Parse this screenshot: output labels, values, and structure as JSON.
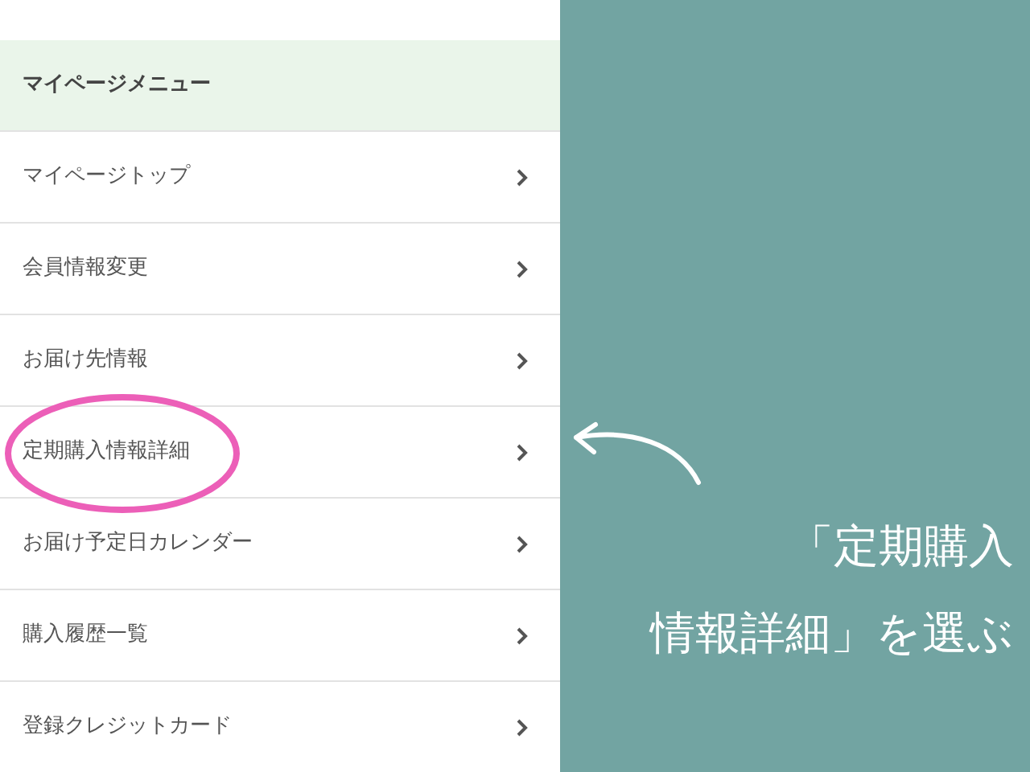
{
  "menu": {
    "title": "マイページメニュー",
    "items": [
      {
        "label": "マイページトップ",
        "circled": false
      },
      {
        "label": "会員情報変更",
        "circled": false
      },
      {
        "label": "お届け先情報",
        "circled": false
      },
      {
        "label": "定期購入情報詳細",
        "circled": true
      },
      {
        "label": "お届け予定日カレンダー",
        "circled": false
      },
      {
        "label": "購入履歴一覧",
        "circled": false
      },
      {
        "label": "登録クレジットカード",
        "circled": false
      }
    ]
  },
  "callout": {
    "lines": [
      "「定期購入",
      "情報詳細」を選ぶ"
    ]
  }
}
